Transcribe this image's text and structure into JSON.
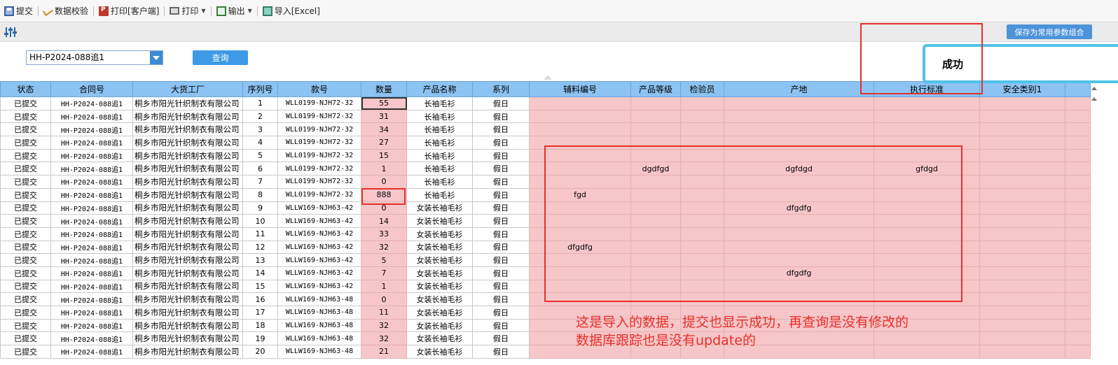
{
  "toolbar": {
    "items": [
      {
        "label": "提交"
      },
      {
        "label": "数据校验"
      },
      {
        "label": "打印[客户端]"
      },
      {
        "label": "打印"
      },
      {
        "label": "输出"
      },
      {
        "label": "导入[Excel]"
      }
    ]
  },
  "filter": {
    "save_params_label": "保存为常用参数组合",
    "contract_value": "HH-P2024-088追1",
    "query_label": "查询"
  },
  "toast": {
    "text": "成功"
  },
  "table": {
    "columns": [
      "状态",
      "合同号",
      "大货工厂",
      "序列号",
      "款号",
      "数量",
      "产品名称",
      "系列",
      "辅料编号",
      "产品等级",
      "检验员",
      "产地",
      "执行标准",
      "安全类别1"
    ],
    "rows": [
      [
        "已提交",
        "HH-P2024-088追1",
        "桐乡市阳光针织制衣有限公司",
        "1",
        "WLL0199-NJH72-32",
        "55",
        "长袖毛衫",
        "假日",
        "",
        "",
        "",
        "",
        "",
        ""
      ],
      [
        "已提交",
        "HH-P2024-088追1",
        "桐乡市阳光针织制衣有限公司",
        "2",
        "WLL0199-NJH72-32",
        "31",
        "长袖毛衫",
        "假日",
        "",
        "",
        "",
        "",
        "",
        ""
      ],
      [
        "已提交",
        "HH-P2024-088追1",
        "桐乡市阳光针织制衣有限公司",
        "3",
        "WLL0199-NJH72-32",
        "34",
        "长袖毛衫",
        "假日",
        "",
        "",
        "",
        "",
        "",
        ""
      ],
      [
        "已提交",
        "HH-P2024-088追1",
        "桐乡市阳光针织制衣有限公司",
        "4",
        "WLL0199-NJH72-32",
        "27",
        "长袖毛衫",
        "假日",
        "",
        "",
        "",
        "",
        "",
        ""
      ],
      [
        "已提交",
        "HH-P2024-088追1",
        "桐乡市阳光针织制衣有限公司",
        "5",
        "WLL0199-NJH72-32",
        "15",
        "长袖毛衫",
        "假日",
        "",
        "",
        "",
        "",
        "",
        ""
      ],
      [
        "已提交",
        "HH-P2024-088追1",
        "桐乡市阳光针织制衣有限公司",
        "6",
        "WLL0199-NJH72-32",
        "1",
        "长袖毛衫",
        "假日",
        "",
        "dgdfgd",
        "",
        "dgfdgd",
        "gfdgd",
        ""
      ],
      [
        "已提交",
        "HH-P2024-088追1",
        "桐乡市阳光针织制衣有限公司",
        "7",
        "WLL0199-NJH72-32",
        "0",
        "长袖毛衫",
        "假日",
        "",
        "",
        "",
        "",
        "",
        ""
      ],
      [
        "已提交",
        "HH-P2024-088追1",
        "桐乡市阳光针织制衣有限公司",
        "8",
        "WLL0199-NJH72-32",
        "888",
        "长袖毛衫",
        "假日",
        "fgd",
        "",
        "",
        "",
        "",
        ""
      ],
      [
        "已提交",
        "HH-P2024-088追1",
        "桐乡市阳光针织制衣有限公司",
        "9",
        "WLLW169-NJH63-42",
        "0",
        "女装长袖毛衫",
        "假日",
        "",
        "",
        "",
        "dfgdfg",
        "",
        ""
      ],
      [
        "已提交",
        "HH-P2024-088追1",
        "桐乡市阳光针织制衣有限公司",
        "10",
        "WLLW169-NJH63-42",
        "14",
        "女装长袖毛衫",
        "假日",
        "",
        "",
        "",
        "",
        "",
        ""
      ],
      [
        "已提交",
        "HH-P2024-088追1",
        "桐乡市阳光针织制衣有限公司",
        "11",
        "WLLW169-NJH63-42",
        "33",
        "女装长袖毛衫",
        "假日",
        "",
        "",
        "",
        "",
        "",
        ""
      ],
      [
        "已提交",
        "HH-P2024-088追1",
        "桐乡市阳光针织制衣有限公司",
        "12",
        "WLLW169-NJH63-42",
        "32",
        "女装长袖毛衫",
        "假日",
        "dfgdfg",
        "",
        "",
        "",
        "",
        ""
      ],
      [
        "已提交",
        "HH-P2024-088追1",
        "桐乡市阳光针织制衣有限公司",
        "13",
        "WLLW169-NJH63-42",
        "5",
        "女装长袖毛衫",
        "假日",
        "",
        "",
        "",
        "",
        "",
        ""
      ],
      [
        "已提交",
        "HH-P2024-088追1",
        "桐乡市阳光针织制衣有限公司",
        "14",
        "WLLW169-NJH63-42",
        "7",
        "女装长袖毛衫",
        "假日",
        "",
        "",
        "",
        "dfgdfg",
        "",
        ""
      ],
      [
        "已提交",
        "HH-P2024-088追1",
        "桐乡市阳光针织制衣有限公司",
        "15",
        "WLLW169-NJH63-42",
        "1",
        "女装长袖毛衫",
        "假日",
        "",
        "",
        "",
        "",
        "",
        ""
      ],
      [
        "已提交",
        "HH-P2024-088追1",
        "桐乡市阳光针织制衣有限公司",
        "16",
        "WLLW169-NJH63-48",
        "0",
        "女装长袖毛衫",
        "假日",
        "",
        "",
        "",
        "",
        "",
        ""
      ],
      [
        "已提交",
        "HH-P2024-088追1",
        "桐乡市阳光针织制衣有限公司",
        "17",
        "WLLW169-NJH63-48",
        "11",
        "女装长袖毛衫",
        "假日",
        "",
        "",
        "",
        "",
        "",
        ""
      ],
      [
        "已提交",
        "HH-P2024-088追1",
        "桐乡市阳光针织制衣有限公司",
        "18",
        "WLLW169-NJH63-48",
        "32",
        "女装长袖毛衫",
        "假日",
        "",
        "",
        "",
        "",
        "",
        ""
      ],
      [
        "已提交",
        "HH-P2024-088追1",
        "桐乡市阳光针织制衣有限公司",
        "19",
        "WLLW169-NJH63-48",
        "32",
        "女装长袖毛衫",
        "假日",
        "",
        "",
        "",
        "",
        "",
        ""
      ],
      [
        "已提交",
        "HH-P2024-088追1",
        "桐乡市阳光针织制衣有限公司",
        "20",
        "WLLW169-NJH63-48",
        "21",
        "女装长袖毛衫",
        "假日",
        "",
        "",
        "",
        "",
        "",
        ""
      ]
    ]
  },
  "annotation": {
    "line1": "这是导入的数据，提交也显示成功，再查询是没有修改的",
    "line2": "数据库跟踪也是没有update的"
  },
  "colors": {
    "header": "#8cc3f2",
    "highlight": "#f7c6c9",
    "annotation": "#e5312a",
    "toast_border": "#4fc3e6"
  }
}
